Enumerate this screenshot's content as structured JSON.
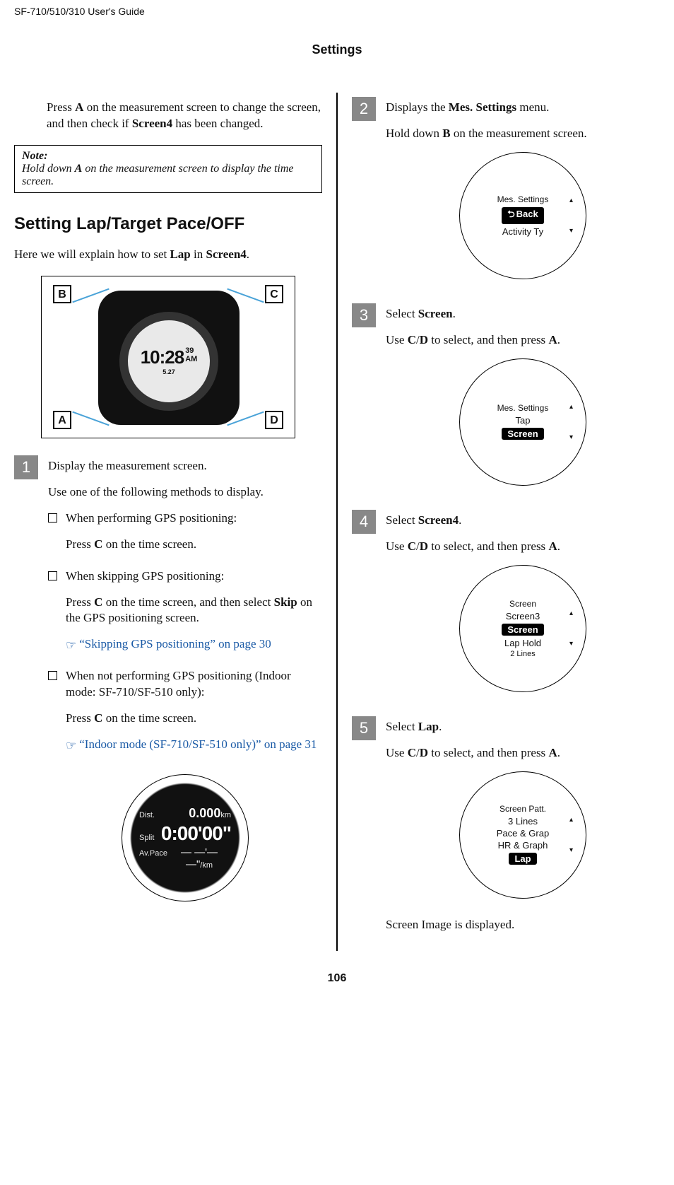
{
  "header": "SF-710/510/310     User's Guide",
  "section_title": "Settings",
  "left": {
    "intro_html": "Press <b>A</b> on the measurement screen to change the screen, and then check if <b>Screen4</b> has been changed.",
    "note_title": "Note:",
    "note_body_html": "Hold down <b>A</b> on the measurement screen to display the time screen.",
    "subhead": "Setting Lap/Target Pace/OFF",
    "explain_html": "Here we will explain how to set <b>Lap</b> in <b>Screen4</b>.",
    "watch_labels": {
      "A": "A",
      "B": "B",
      "C": "C",
      "D": "D"
    },
    "watch_face_time": "10:28",
    "watch_face_sec": "39",
    "watch_face_ampm": "AM",
    "watch_face_sub": "5.27",
    "step1": {
      "num": "1",
      "title": "Display the measurement screen.",
      "desc": "Use one of the following methods to display.",
      "items": [
        {
          "head": "When performing GPS positioning:",
          "body_html": "Press <b>C</b> on the time screen."
        },
        {
          "head": "When skipping GPS positioning:",
          "body_html": "Press <b>C</b> on the time screen, and then select <b>Skip</b> on the GPS positioning screen.",
          "link": "“Skipping GPS positioning” on page 30"
        },
        {
          "head": "When not performing GPS positioning (Indoor mode: SF-710/SF-510 only):",
          "body_html": "Press <b>C</b> on the time screen.",
          "link": "“Indoor mode (SF-710/SF-510 only)” on page 31"
        }
      ],
      "dark_screen": {
        "dist_label": "Dist.",
        "dist_val": "0.000",
        "dist_unit": "km",
        "split_label": "Split",
        "split_val": "0:00'00\"",
        "avpace_label": "Av.Pace",
        "avpace_val": "— —'— —\"",
        "avpace_unit": "/km"
      }
    }
  },
  "right": {
    "steps": [
      {
        "num": "2",
        "title_html": "Displays the <b>Mes. Settings</b> menu.",
        "desc_html": "Hold down <b>B</b> on the measurement screen.",
        "screen": {
          "top": "Mes. Settings",
          "rows": [
            {
              "text": "Back",
              "sel": true,
              "icon": "back"
            },
            {
              "text": "Activity Ty",
              "sel": false
            }
          ]
        }
      },
      {
        "num": "3",
        "title_html": "Select <b>Screen</b>.",
        "desc_html": "Use <b>C</b>/<b>D</b> to select, and then press <b>A</b>.",
        "screen": {
          "top": "Mes. Settings",
          "rows": [
            {
              "text": "Tap",
              "sel": false
            },
            {
              "text": "Screen",
              "sel": true
            }
          ]
        }
      },
      {
        "num": "4",
        "title_html": "Select <b>Screen4</b>.",
        "desc_html": "Use <b>C</b>/<b>D</b> to select, and then press <b>A</b>.",
        "screen": {
          "top": "Screen",
          "rows": [
            {
              "text": "Screen3",
              "sel": false
            },
            {
              "text": "Screen",
              "sel": true
            },
            {
              "text": "Lap Hold",
              "sel": false
            }
          ],
          "bottom": "2 Lines"
        }
      },
      {
        "num": "5",
        "title_html": "Select <b>Lap</b>.",
        "desc_html": "Use <b>C</b>/<b>D</b> to select, and then press <b>A</b>.",
        "screen": {
          "top": "Screen Patt.",
          "rows": [
            {
              "text": "3 Lines",
              "sel": false
            },
            {
              "text": "Pace & Grap",
              "sel": false
            },
            {
              "text": "HR & Graph",
              "sel": false
            },
            {
              "text": "Lap",
              "sel": true
            }
          ]
        },
        "after": "Screen Image is displayed."
      }
    ]
  },
  "page_number": "106"
}
